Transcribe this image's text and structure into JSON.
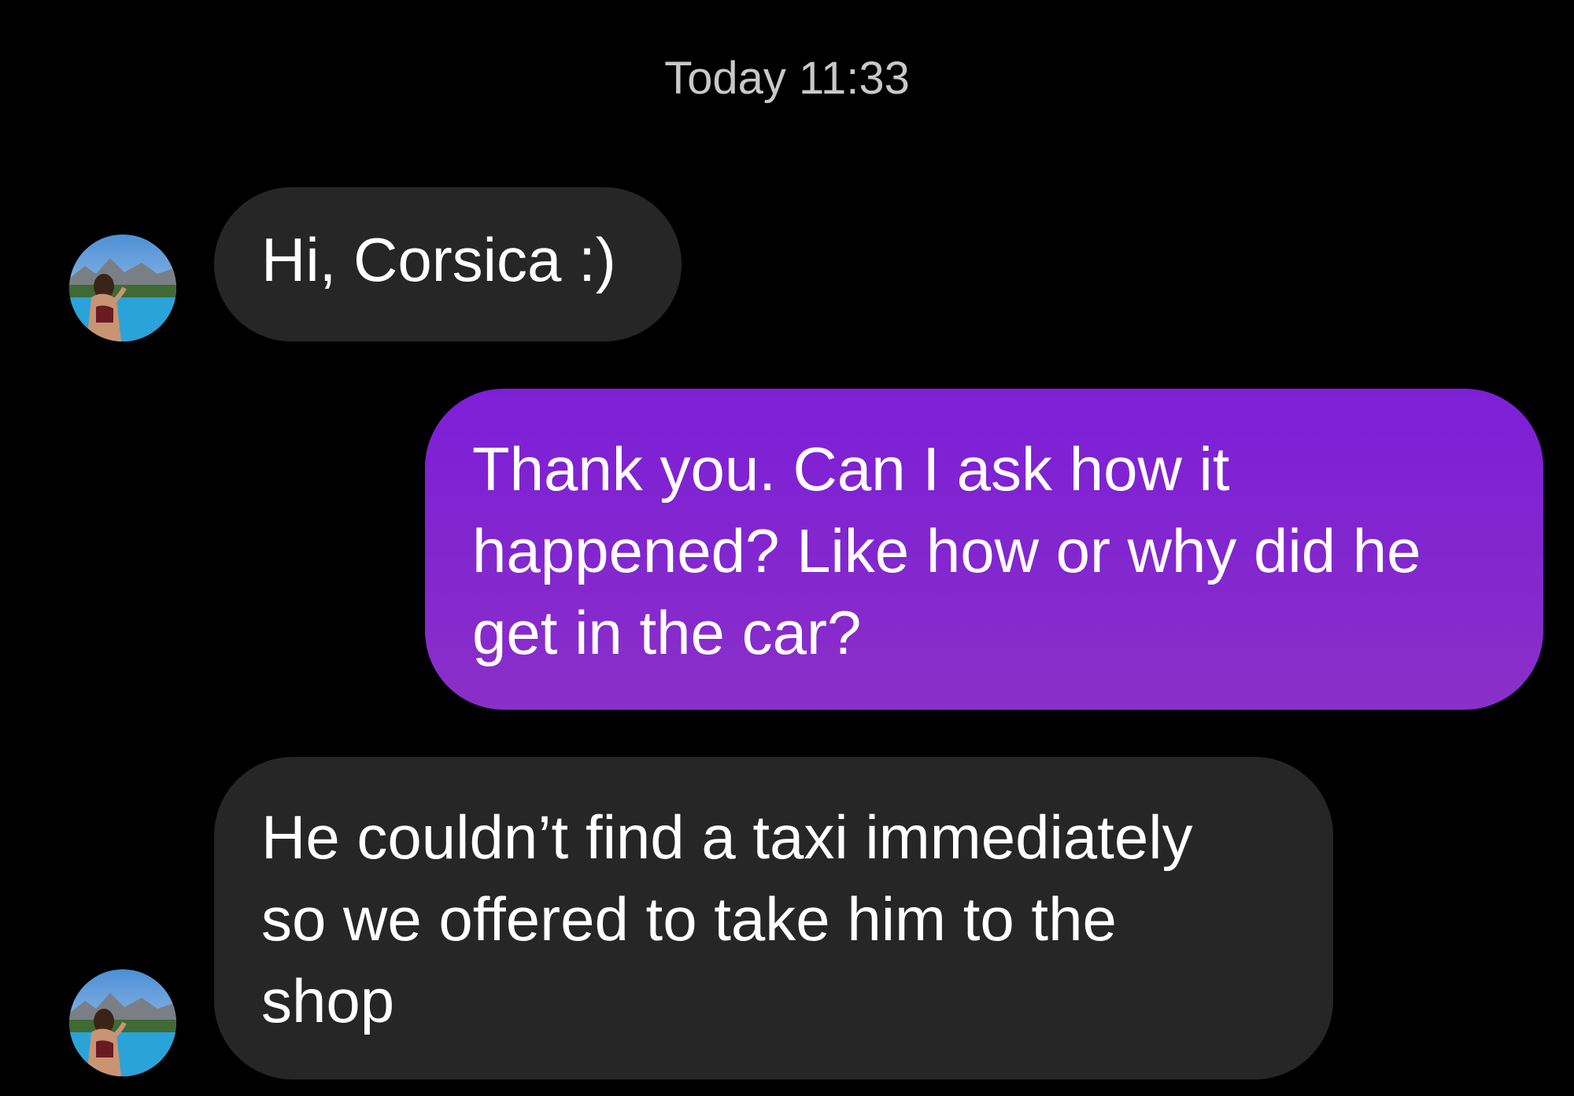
{
  "conversation": {
    "timestamp": "Today 11:33",
    "messages": [
      {
        "direction": "incoming",
        "lines": [
          "Hi, Corsica :)"
        ]
      },
      {
        "direction": "outgoing",
        "lines": [
          "Thank you. Can I ask how it",
          "happened? Like how or why did he",
          "get in the car?"
        ]
      },
      {
        "direction": "incoming",
        "lines": [
          "He couldn’t find a taxi immediately",
          "so we offered to take him to the",
          "shop"
        ]
      }
    ]
  },
  "colors": {
    "background": "#000000",
    "incoming_bubble": "#262626",
    "outgoing_bubble": "#8327cf",
    "timestamp_text": "#c8c8c8"
  },
  "icons": {
    "contact_avatar": "contact-avatar-photo"
  }
}
